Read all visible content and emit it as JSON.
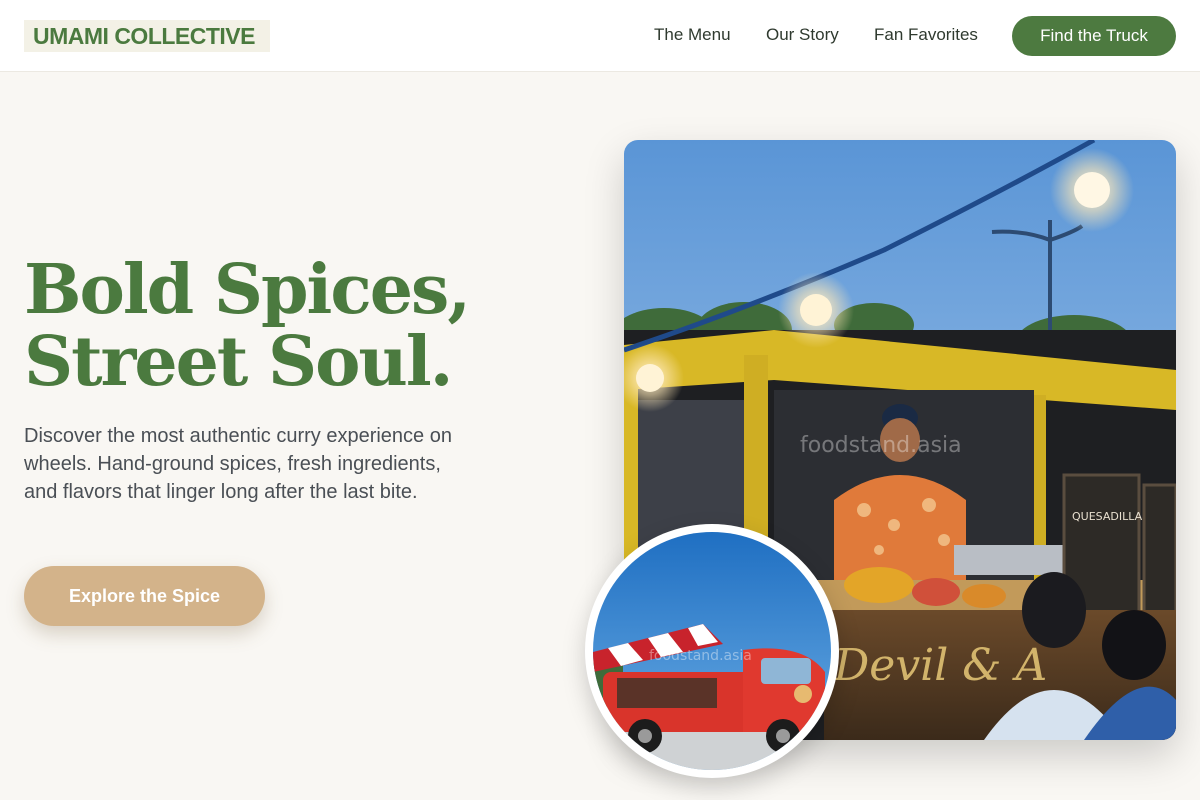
{
  "brand": {
    "name": "UMAMI COLLECTIVE",
    "primary_color": "#4d7a40",
    "accent_color": "#d3b38a",
    "background_color": "#f9f7f3"
  },
  "nav": {
    "links": [
      {
        "label": "The Menu"
      },
      {
        "label": "Our Story"
      },
      {
        "label": "Fan Favorites"
      }
    ],
    "cta_label": "Find the Truck"
  },
  "hero": {
    "headline_line1": "Bold Spices,",
    "headline_line2": "Street Soul.",
    "description": "Discover the most authentic curry experience on wheels. Hand-ground spices, fresh ingredients, and flavors that linger long after the last bite.",
    "cta_label": "Explore the Spice"
  },
  "images": {
    "main_watermark": "foodstand.asia",
    "main_sign_text": "Devil & A",
    "main_menu_board_text": "QUESADILLA",
    "circle_watermark": "foodstand.asia"
  }
}
